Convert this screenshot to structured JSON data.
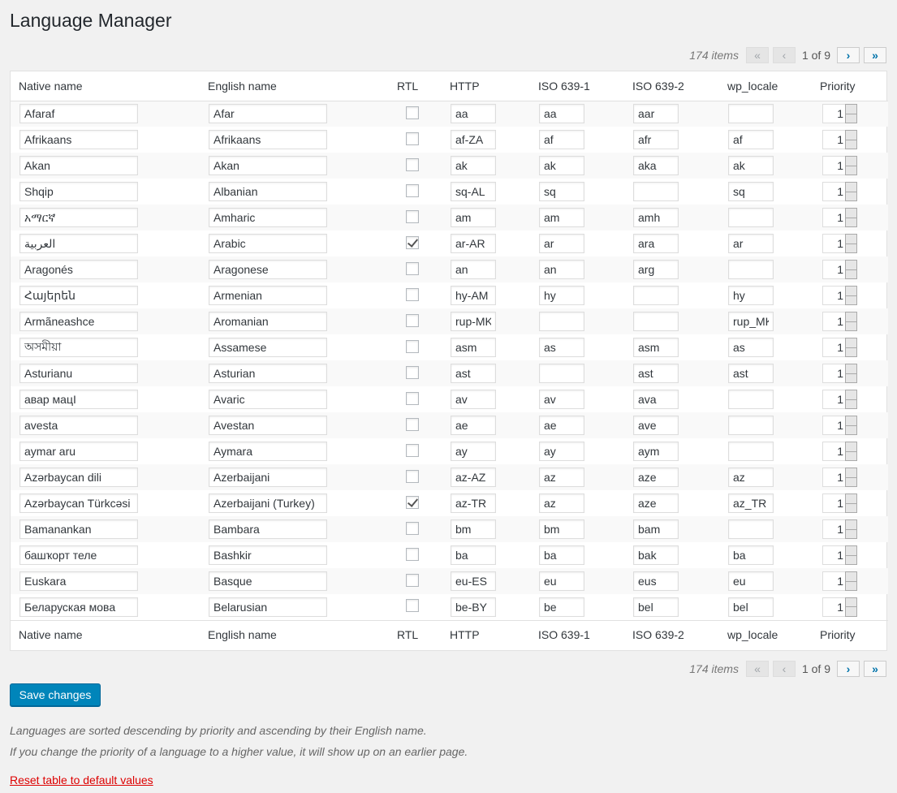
{
  "title": "Language Manager",
  "pagination": {
    "count": "174 items",
    "first": "«",
    "prev": "‹",
    "current": "1 of 9",
    "next": "›",
    "last": "»"
  },
  "columns": [
    "Native name",
    "English name",
    "RTL",
    "HTTP",
    "ISO 639-1",
    "ISO 639-2",
    "wp_locale",
    "Priority"
  ],
  "rows": [
    {
      "native": "Afaraf",
      "english": "Afar",
      "rtl": false,
      "http": "aa",
      "iso1": "aa",
      "iso2": "aar",
      "locale": "",
      "priority": "1"
    },
    {
      "native": "Afrikaans",
      "english": "Afrikaans",
      "rtl": false,
      "http": "af-ZA",
      "iso1": "af",
      "iso2": "afr",
      "locale": "af",
      "priority": "1"
    },
    {
      "native": "Akan",
      "english": "Akan",
      "rtl": false,
      "http": "ak",
      "iso1": "ak",
      "iso2": "aka",
      "locale": "ak",
      "priority": "1"
    },
    {
      "native": "Shqip",
      "english": "Albanian",
      "rtl": false,
      "http": "sq-AL",
      "iso1": "sq",
      "iso2": "",
      "locale": "sq",
      "priority": "1"
    },
    {
      "native": "አማርኛ",
      "english": "Amharic",
      "rtl": false,
      "http": "am",
      "iso1": "am",
      "iso2": "amh",
      "locale": "",
      "priority": "1"
    },
    {
      "native": "العربية",
      "english": "Arabic",
      "rtl": true,
      "http": "ar-AR",
      "iso1": "ar",
      "iso2": "ara",
      "locale": "ar",
      "priority": "1"
    },
    {
      "native": "Aragonés",
      "english": "Aragonese",
      "rtl": false,
      "http": "an",
      "iso1": "an",
      "iso2": "arg",
      "locale": "",
      "priority": "1"
    },
    {
      "native": "Հայերեն",
      "english": "Armenian",
      "rtl": false,
      "http": "hy-AM",
      "iso1": "hy",
      "iso2": "",
      "locale": "hy",
      "priority": "1"
    },
    {
      "native": "Armãneashce",
      "english": "Aromanian",
      "rtl": false,
      "http": "rup-MK",
      "iso1": "",
      "iso2": "",
      "locale": "rup_MK",
      "priority": "1"
    },
    {
      "native": "অসমীয়া",
      "english": "Assamese",
      "rtl": false,
      "http": "asm",
      "iso1": "as",
      "iso2": "asm",
      "locale": "as",
      "priority": "1"
    },
    {
      "native": "Asturianu",
      "english": "Asturian",
      "rtl": false,
      "http": "ast",
      "iso1": "",
      "iso2": "ast",
      "locale": "ast",
      "priority": "1"
    },
    {
      "native": "авар мацӀ",
      "english": "Avaric",
      "rtl": false,
      "http": "av",
      "iso1": "av",
      "iso2": "ava",
      "locale": "",
      "priority": "1"
    },
    {
      "native": "avesta",
      "english": "Avestan",
      "rtl": false,
      "http": "ae",
      "iso1": "ae",
      "iso2": "ave",
      "locale": "",
      "priority": "1"
    },
    {
      "native": "aymar aru",
      "english": "Aymara",
      "rtl": false,
      "http": "ay",
      "iso1": "ay",
      "iso2": "aym",
      "locale": "",
      "priority": "1"
    },
    {
      "native": "Azərbaycan dili",
      "english": "Azerbaijani",
      "rtl": false,
      "http": "az-AZ",
      "iso1": "az",
      "iso2": "aze",
      "locale": "az",
      "priority": "1"
    },
    {
      "native": "Azərbaycan Türkcəsi",
      "english": "Azerbaijani (Turkey)",
      "rtl": true,
      "http": "az-TR",
      "iso1": "az",
      "iso2": "aze",
      "locale": "az_TR",
      "priority": "1"
    },
    {
      "native": "Bamanankan",
      "english": "Bambara",
      "rtl": false,
      "http": "bm",
      "iso1": "bm",
      "iso2": "bam",
      "locale": "",
      "priority": "1"
    },
    {
      "native": "башҡорт теле",
      "english": "Bashkir",
      "rtl": false,
      "http": "ba",
      "iso1": "ba",
      "iso2": "bak",
      "locale": "ba",
      "priority": "1"
    },
    {
      "native": "Euskara",
      "english": "Basque",
      "rtl": false,
      "http": "eu-ES",
      "iso1": "eu",
      "iso2": "eus",
      "locale": "eu",
      "priority": "1"
    },
    {
      "native": "Беларуская мова",
      "english": "Belarusian",
      "rtl": false,
      "http": "be-BY",
      "iso1": "be",
      "iso2": "bel",
      "locale": "bel",
      "priority": "1"
    }
  ],
  "save_label": "Save changes",
  "notes": [
    "Languages are sorted descending by priority and ascending by their English name.",
    "If you change the priority of a language to a higher value, it will show up on an earlier page."
  ],
  "reset_label": "Reset table to default values"
}
